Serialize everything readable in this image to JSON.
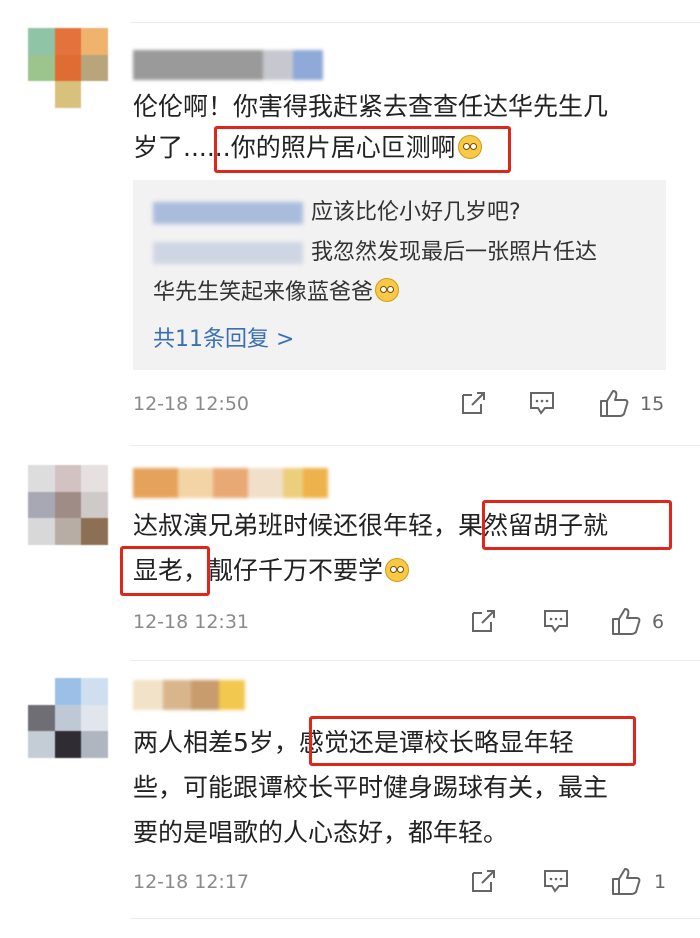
{
  "comments": [
    {
      "text_line1": "伦伦啊！你害得我赶紧去查查任达华先生几",
      "text_line2_pre": "岁了......",
      "text_line2_hl": "你的照片居心叵测啊",
      "replies": {
        "reply1": "应该比伦小好几岁吧?",
        "reply2_part1": "我忽然发现最后一张照片任达",
        "reply2_part2": "华先生笑起来像蓝爸爸",
        "more": "共11条回复 >"
      },
      "time": "12-18 12:50",
      "likes": "15"
    },
    {
      "text_line1_pre": "达叔演兄弟班时候还很年轻，",
      "text_line1_hl": "果然留胡子就",
      "text_line2_hl": "显老，",
      "text_line2_post": "靓仔千万不要学",
      "time": "12-18 12:31",
      "likes": "6"
    },
    {
      "text_line1_pre": "两人相差5岁，",
      "text_line1_hl": "感觉还是谭校长略显年轻",
      "text_line2": "些，可能跟谭校长平时健身踢球有关，最主",
      "text_line3": "要的是唱歌的人心态好，都年轻。",
      "time": "12-18 12:17",
      "likes": "1"
    }
  ],
  "colors": {
    "highlight": "#e0251b",
    "link": "#3b6fb5",
    "meta": "#8a8a8a"
  },
  "icons": [
    "share-icon",
    "comment-icon",
    "thumbs-up-icon",
    "smiley-emoji"
  ]
}
